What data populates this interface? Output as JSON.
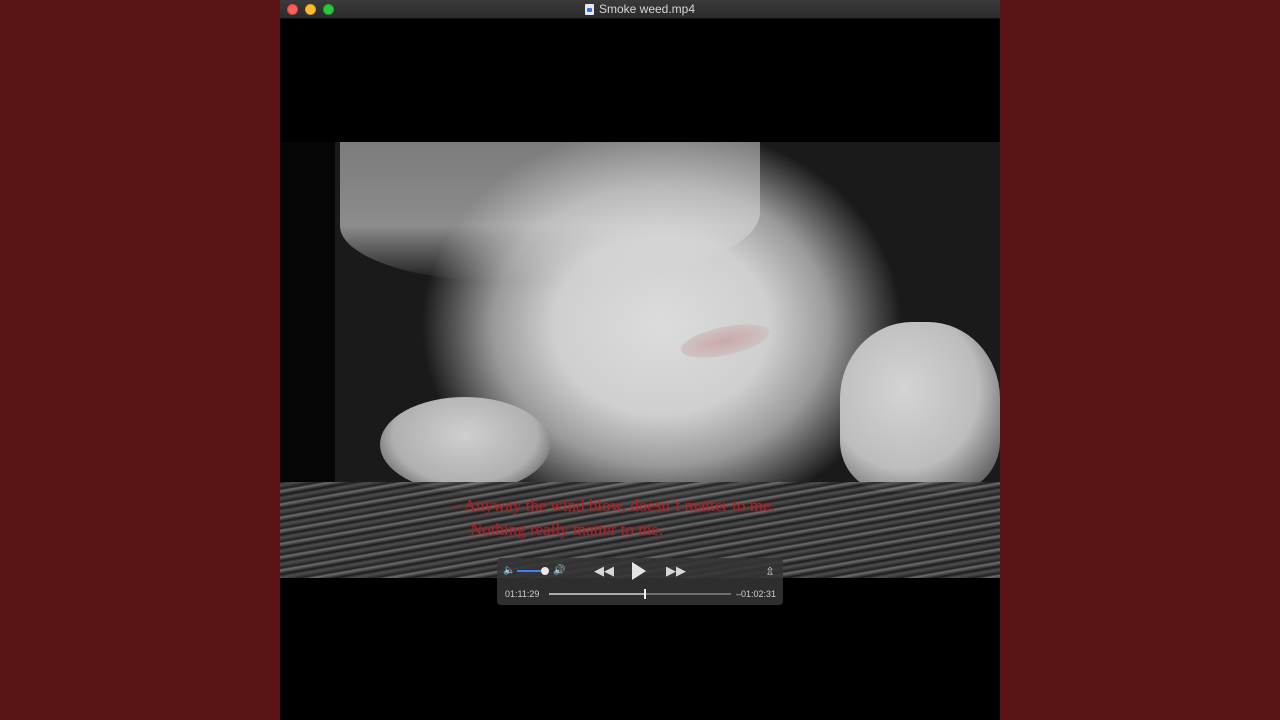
{
  "window": {
    "title": "Smoke weed.mp4",
    "file_icon": "video-file-icon"
  },
  "video": {
    "subtitle_lines": [
      "– Anyway the wind blow, doesn`t matter to me.",
      "Nothing really matter to me."
    ]
  },
  "controls": {
    "volume_level": 0.9,
    "icons": {
      "volume_low": "speaker-low-icon",
      "volume_high": "speaker-high-icon",
      "rewind": "rewind-icon",
      "play": "play-icon",
      "fast_forward": "fast-forward-icon",
      "share": "share-icon"
    },
    "time_elapsed": "01:11:29",
    "time_remaining": "–01:02:31",
    "progress_fraction": 0.53
  },
  "colors": {
    "background": "#5a1416",
    "subtitle": "#d0131c",
    "volume_accent": "#3b82f6",
    "close": "#fe5f57",
    "minimize": "#febc2e",
    "zoom": "#28c840"
  }
}
